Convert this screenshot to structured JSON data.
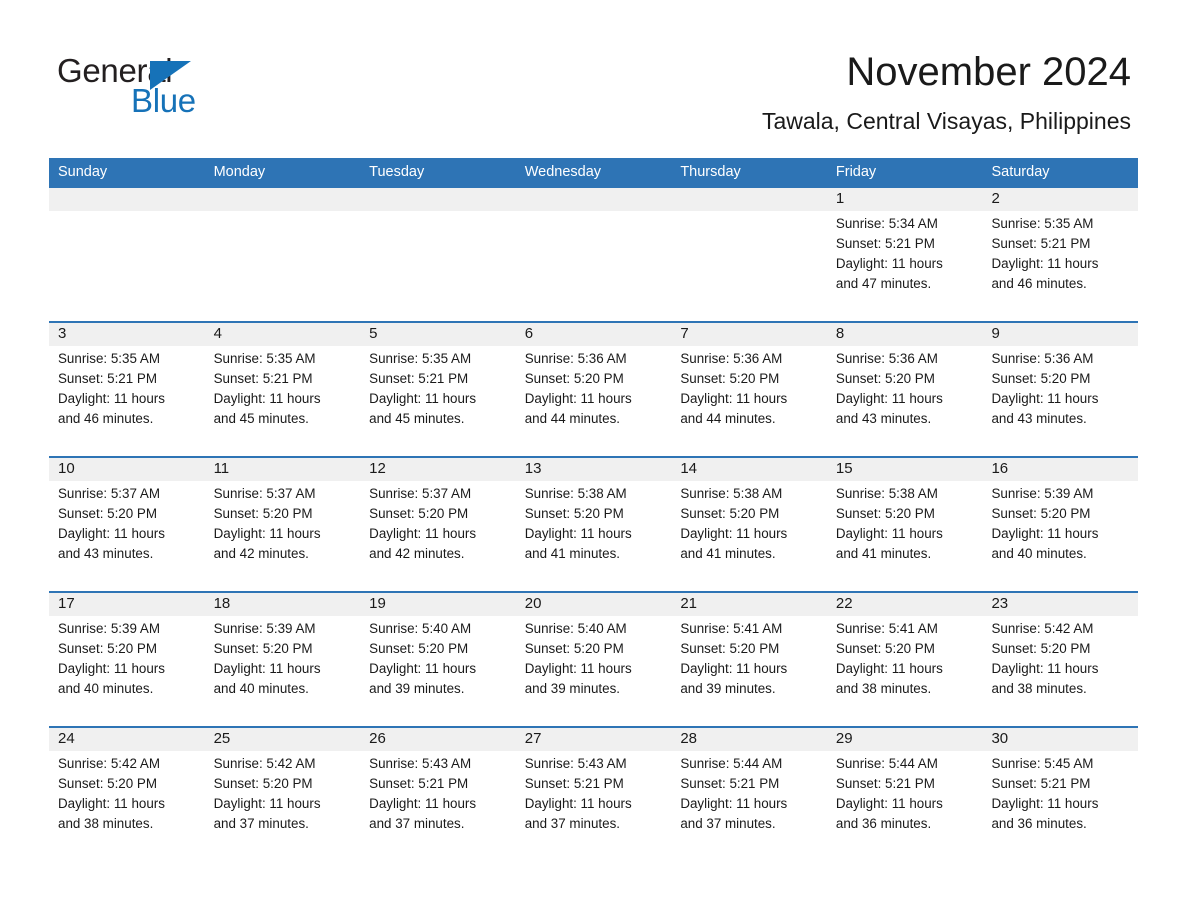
{
  "logo": {
    "text_primary": "General",
    "text_secondary": "Blue",
    "triangle_color": "#1672b8",
    "primary_color": "#231f20"
  },
  "header": {
    "title": "November 2024",
    "location": "Tawala, Central Visayas, Philippines"
  },
  "theme": {
    "header_blue": "#2e74b5",
    "row_band_gray": "#f0f0f0",
    "text_color": "#1a1a1a"
  },
  "calendar": {
    "weekdays": [
      "Sunday",
      "Monday",
      "Tuesday",
      "Wednesday",
      "Thursday",
      "Friday",
      "Saturday"
    ],
    "weeks": [
      [
        {
          "day": "",
          "lines": []
        },
        {
          "day": "",
          "lines": []
        },
        {
          "day": "",
          "lines": []
        },
        {
          "day": "",
          "lines": []
        },
        {
          "day": "",
          "lines": []
        },
        {
          "day": "1",
          "lines": [
            "Sunrise: 5:34 AM",
            "Sunset: 5:21 PM",
            "Daylight: 11 hours",
            "and 47 minutes."
          ]
        },
        {
          "day": "2",
          "lines": [
            "Sunrise: 5:35 AM",
            "Sunset: 5:21 PM",
            "Daylight: 11 hours",
            "and 46 minutes."
          ]
        }
      ],
      [
        {
          "day": "3",
          "lines": [
            "Sunrise: 5:35 AM",
            "Sunset: 5:21 PM",
            "Daylight: 11 hours",
            "and 46 minutes."
          ]
        },
        {
          "day": "4",
          "lines": [
            "Sunrise: 5:35 AM",
            "Sunset: 5:21 PM",
            "Daylight: 11 hours",
            "and 45 minutes."
          ]
        },
        {
          "day": "5",
          "lines": [
            "Sunrise: 5:35 AM",
            "Sunset: 5:21 PM",
            "Daylight: 11 hours",
            "and 45 minutes."
          ]
        },
        {
          "day": "6",
          "lines": [
            "Sunrise: 5:36 AM",
            "Sunset: 5:20 PM",
            "Daylight: 11 hours",
            "and 44 minutes."
          ]
        },
        {
          "day": "7",
          "lines": [
            "Sunrise: 5:36 AM",
            "Sunset: 5:20 PM",
            "Daylight: 11 hours",
            "and 44 minutes."
          ]
        },
        {
          "day": "8",
          "lines": [
            "Sunrise: 5:36 AM",
            "Sunset: 5:20 PM",
            "Daylight: 11 hours",
            "and 43 minutes."
          ]
        },
        {
          "day": "9",
          "lines": [
            "Sunrise: 5:36 AM",
            "Sunset: 5:20 PM",
            "Daylight: 11 hours",
            "and 43 minutes."
          ]
        }
      ],
      [
        {
          "day": "10",
          "lines": [
            "Sunrise: 5:37 AM",
            "Sunset: 5:20 PM",
            "Daylight: 11 hours",
            "and 43 minutes."
          ]
        },
        {
          "day": "11",
          "lines": [
            "Sunrise: 5:37 AM",
            "Sunset: 5:20 PM",
            "Daylight: 11 hours",
            "and 42 minutes."
          ]
        },
        {
          "day": "12",
          "lines": [
            "Sunrise: 5:37 AM",
            "Sunset: 5:20 PM",
            "Daylight: 11 hours",
            "and 42 minutes."
          ]
        },
        {
          "day": "13",
          "lines": [
            "Sunrise: 5:38 AM",
            "Sunset: 5:20 PM",
            "Daylight: 11 hours",
            "and 41 minutes."
          ]
        },
        {
          "day": "14",
          "lines": [
            "Sunrise: 5:38 AM",
            "Sunset: 5:20 PM",
            "Daylight: 11 hours",
            "and 41 minutes."
          ]
        },
        {
          "day": "15",
          "lines": [
            "Sunrise: 5:38 AM",
            "Sunset: 5:20 PM",
            "Daylight: 11 hours",
            "and 41 minutes."
          ]
        },
        {
          "day": "16",
          "lines": [
            "Sunrise: 5:39 AM",
            "Sunset: 5:20 PM",
            "Daylight: 11 hours",
            "and 40 minutes."
          ]
        }
      ],
      [
        {
          "day": "17",
          "lines": [
            "Sunrise: 5:39 AM",
            "Sunset: 5:20 PM",
            "Daylight: 11 hours",
            "and 40 minutes."
          ]
        },
        {
          "day": "18",
          "lines": [
            "Sunrise: 5:39 AM",
            "Sunset: 5:20 PM",
            "Daylight: 11 hours",
            "and 40 minutes."
          ]
        },
        {
          "day": "19",
          "lines": [
            "Sunrise: 5:40 AM",
            "Sunset: 5:20 PM",
            "Daylight: 11 hours",
            "and 39 minutes."
          ]
        },
        {
          "day": "20",
          "lines": [
            "Sunrise: 5:40 AM",
            "Sunset: 5:20 PM",
            "Daylight: 11 hours",
            "and 39 minutes."
          ]
        },
        {
          "day": "21",
          "lines": [
            "Sunrise: 5:41 AM",
            "Sunset: 5:20 PM",
            "Daylight: 11 hours",
            "and 39 minutes."
          ]
        },
        {
          "day": "22",
          "lines": [
            "Sunrise: 5:41 AM",
            "Sunset: 5:20 PM",
            "Daylight: 11 hours",
            "and 38 minutes."
          ]
        },
        {
          "day": "23",
          "lines": [
            "Sunrise: 5:42 AM",
            "Sunset: 5:20 PM",
            "Daylight: 11 hours",
            "and 38 minutes."
          ]
        }
      ],
      [
        {
          "day": "24",
          "lines": [
            "Sunrise: 5:42 AM",
            "Sunset: 5:20 PM",
            "Daylight: 11 hours",
            "and 38 minutes."
          ]
        },
        {
          "day": "25",
          "lines": [
            "Sunrise: 5:42 AM",
            "Sunset: 5:20 PM",
            "Daylight: 11 hours",
            "and 37 minutes."
          ]
        },
        {
          "day": "26",
          "lines": [
            "Sunrise: 5:43 AM",
            "Sunset: 5:21 PM",
            "Daylight: 11 hours",
            "and 37 minutes."
          ]
        },
        {
          "day": "27",
          "lines": [
            "Sunrise: 5:43 AM",
            "Sunset: 5:21 PM",
            "Daylight: 11 hours",
            "and 37 minutes."
          ]
        },
        {
          "day": "28",
          "lines": [
            "Sunrise: 5:44 AM",
            "Sunset: 5:21 PM",
            "Daylight: 11 hours",
            "and 37 minutes."
          ]
        },
        {
          "day": "29",
          "lines": [
            "Sunrise: 5:44 AM",
            "Sunset: 5:21 PM",
            "Daylight: 11 hours",
            "and 36 minutes."
          ]
        },
        {
          "day": "30",
          "lines": [
            "Sunrise: 5:45 AM",
            "Sunset: 5:21 PM",
            "Daylight: 11 hours",
            "and 36 minutes."
          ]
        }
      ]
    ]
  }
}
